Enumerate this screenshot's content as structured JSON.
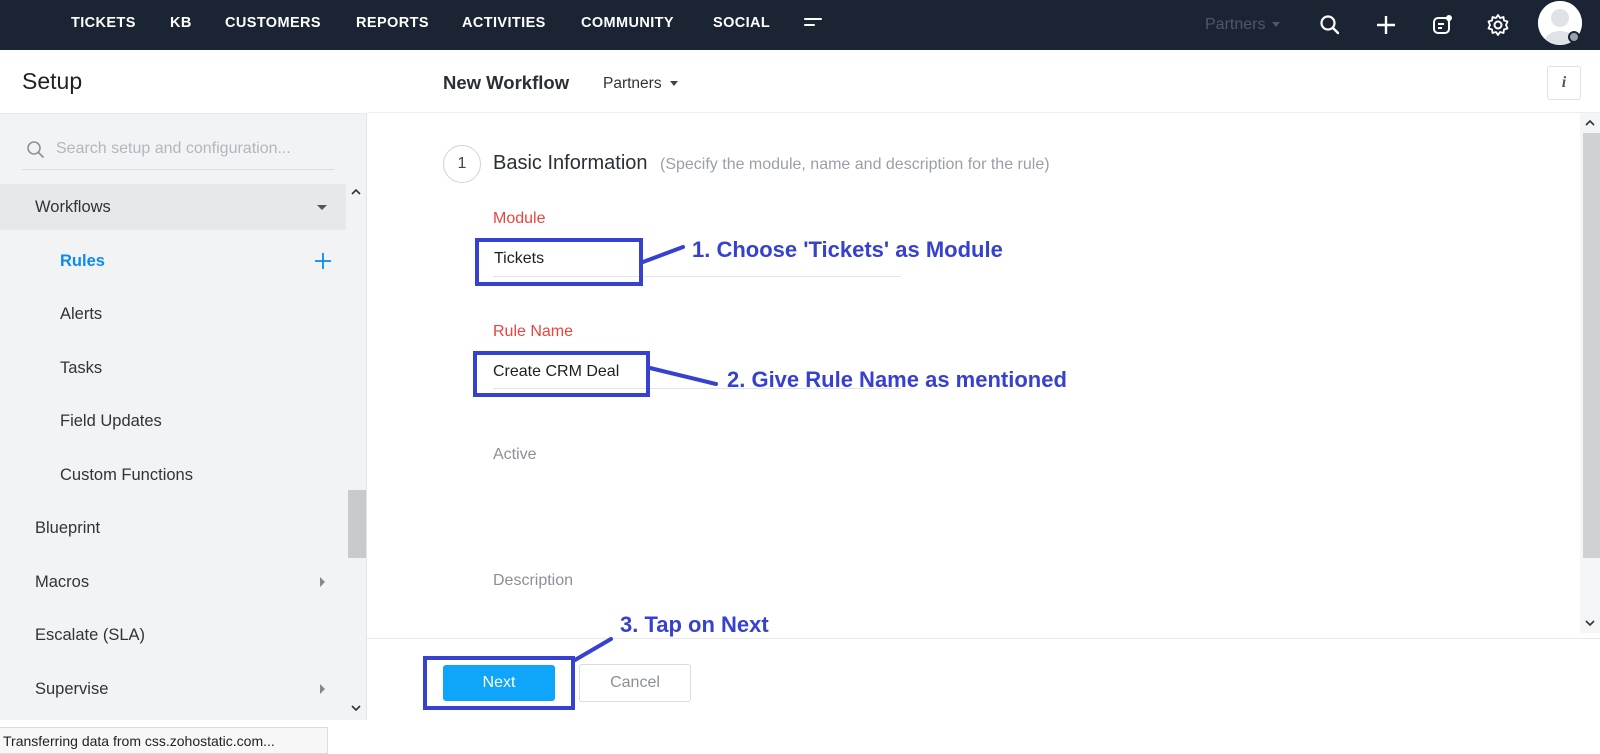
{
  "topnav": {
    "items": [
      "TICKETS",
      "KB",
      "CUSTOMERS",
      "REPORTS",
      "ACTIVITIES",
      "COMMUNITY",
      "SOCIAL"
    ],
    "department": "Partners",
    "icons": [
      "search-icon",
      "plus-icon",
      "compose-icon",
      "gear-icon",
      "avatar"
    ]
  },
  "sidebar": {
    "title": "Setup",
    "search_placeholder": "Search setup and configuration...",
    "items": [
      {
        "label": "Workflows",
        "level": "top",
        "expanded": true
      },
      {
        "label": "Rules",
        "level": "sub",
        "selected": true
      },
      {
        "label": "Alerts",
        "level": "sub"
      },
      {
        "label": "Tasks",
        "level": "sub"
      },
      {
        "label": "Field Updates",
        "level": "sub"
      },
      {
        "label": "Custom Functions",
        "level": "sub"
      },
      {
        "label": "Blueprint",
        "level": "top"
      },
      {
        "label": "Macros",
        "level": "top",
        "has_children": true
      },
      {
        "label": "Escalate (SLA)",
        "level": "top"
      },
      {
        "label": "Supervise",
        "level": "top",
        "has_children": true
      }
    ]
  },
  "main": {
    "title": "New Workflow",
    "department": "Partners",
    "info_label": "i",
    "step": {
      "number": "1",
      "title": "Basic Information",
      "subtitle": "(Specify the module, name and description for the rule)"
    },
    "fields": {
      "module_label": "Module",
      "module_value": "Tickets",
      "rule_name_label": "Rule Name",
      "rule_name_value": "Create CRM Deal",
      "active_label": "Active",
      "description_label": "Description"
    },
    "buttons": {
      "next": "Next",
      "cancel": "Cancel"
    }
  },
  "annotations": {
    "step1": "1. Choose 'Tickets' as Module",
    "step2": "2. Give Rule Name as mentioned",
    "step3": "3. Tap on Next",
    "color": "#3741d0"
  },
  "statusbar": "Transferring data from css.zohostatic.com...",
  "colors": {
    "nav_bg": "#1b2433",
    "accent": "#0ea5fb",
    "selected": "#0b8bf0",
    "required": "#e8453c"
  }
}
